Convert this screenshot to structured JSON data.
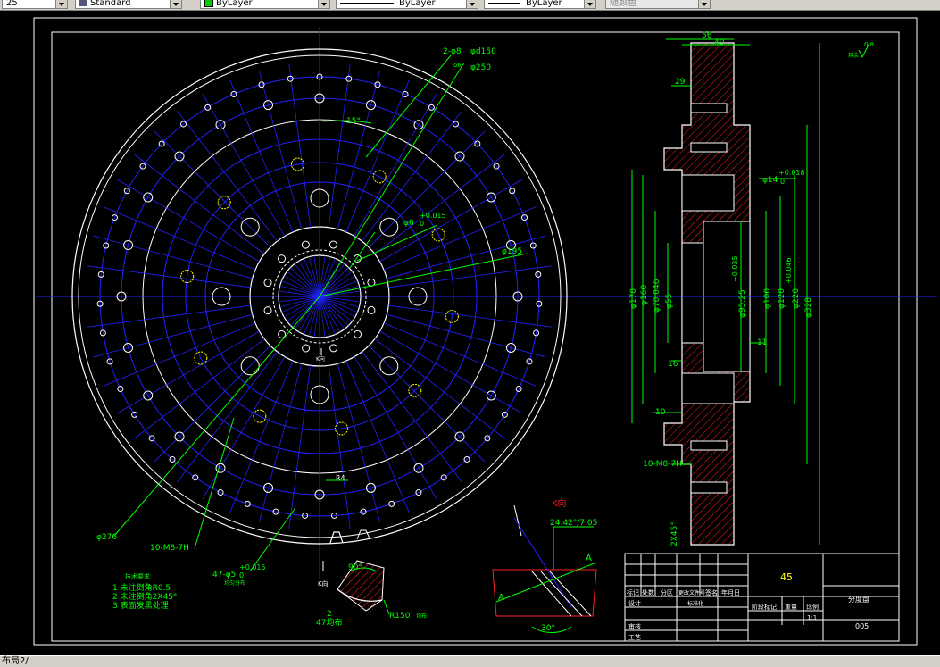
{
  "toolbar": {
    "dimstyle_value": "25",
    "textstyle_value": "Standard",
    "layer_value": "ByLayer",
    "linetype_value": "ByLayer",
    "lineweight_value": "ByLayer",
    "plotstyle_value": "随颜色"
  },
  "colors": {
    "blue": "#2222ff",
    "green": "#00ff00",
    "yellow": "#ffff00",
    "red": "#ff2020",
    "white": "#ffffff"
  },
  "drawing": {
    "front_view": {
      "dim_holes_top": "2-φ8",
      "dim_top_small": "φd150",
      "dim_tol_small": "δ6",
      "dim_d250": "φ250",
      "dim_angle": "15°",
      "dim_d6": "φ6",
      "dim_d6_tol": "+0.015",
      "dim_d6_tol2": "0",
      "dim_d195": "φ195",
      "dim_d276": "φ276",
      "dim_m8": "10-M8-7H",
      "dim_47": "47-φ5",
      "dim_47_tol": "+0.015",
      "dim_47_tol2": "0",
      "dim_47_note": "均匀分布",
      "dim_r4": "R4",
      "k_label": "K向"
    },
    "tech_req": {
      "title": "技术要求",
      "items": [
        "1  未注倒角R0.5",
        "2  未注倒角2X45°",
        "3  表面发黑处理"
      ]
    },
    "k_view": {
      "angle": "90°",
      "r150": "R150",
      "r150_note": "均布",
      "n_label": "2",
      "n47": "47均布",
      "k_label": "K向"
    },
    "section_view": {
      "dim_56": "56",
      "dim_40": "40",
      "dim_29": "29",
      "dim_16": "16",
      "dim_10": "10",
      "dim_11": "11",
      "dim_d14": "φ14",
      "dim_d14_tol": "+0.018",
      "dim_d14_tol2": "0",
      "dim_d170": "φ170",
      "dim_d160": "φ160",
      "dim_d70": "φ70.046",
      "dim_d55": "φ55",
      "dim_d95": "φ95.25",
      "dim_d95_tol": "+0.035",
      "dim_d100": "φ100",
      "dim_d120": "φ120",
      "dim_d220": "φ220",
      "dim_d220_tol": "+0.046",
      "dim_d328": "φ328",
      "dim_m8": "10-M8-7H",
      "dim_chamfer": "2X45°",
      "rough": "0.8",
      "rough_note": "其余"
    },
    "detail": {
      "k_label": "K向",
      "dim_angle": "24.42°/7.05",
      "a_label": "A",
      "a_label2": "A",
      "angle_30": "30°"
    },
    "title_block": {
      "material": "45",
      "part_name": "分度盘",
      "drawing_no": "005",
      "scale": "1:1",
      "row_labels": [
        "标记",
        "处数",
        "分区",
        "更改文件号",
        "签名",
        "年月日"
      ],
      "design": "设计",
      "standard": "标准化",
      "stage": "阶段标记",
      "weight": "重量",
      "ratio": "比例",
      "review": "审核",
      "process": "工艺"
    }
  },
  "status": {
    "layout_tab": "布局2/"
  }
}
